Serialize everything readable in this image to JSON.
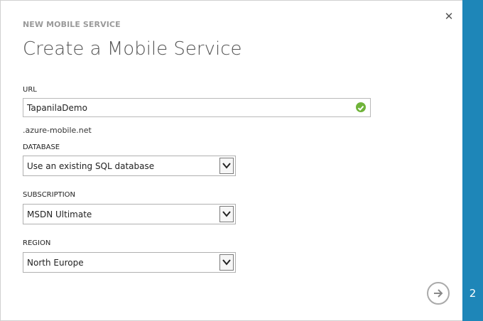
{
  "dialog": {
    "eyebrow": "NEW MOBILE SERVICE",
    "title": "Create a Mobile Service",
    "close_icon": "close-icon"
  },
  "url": {
    "label": "URL",
    "value": "TapanilaDemo",
    "valid_icon": "check-icon",
    "suffix": ".azure-mobile.net"
  },
  "database": {
    "label": "DATABASE",
    "selected": "Use an existing SQL database"
  },
  "subscription": {
    "label": "SUBSCRIPTION",
    "selected": "MSDN Ultimate"
  },
  "region": {
    "label": "REGION",
    "selected": "North Europe"
  },
  "wizard": {
    "step": "2",
    "next_icon": "arrow-right-icon"
  },
  "colors": {
    "accent": "#1e86b8",
    "valid": "#6fb339"
  }
}
